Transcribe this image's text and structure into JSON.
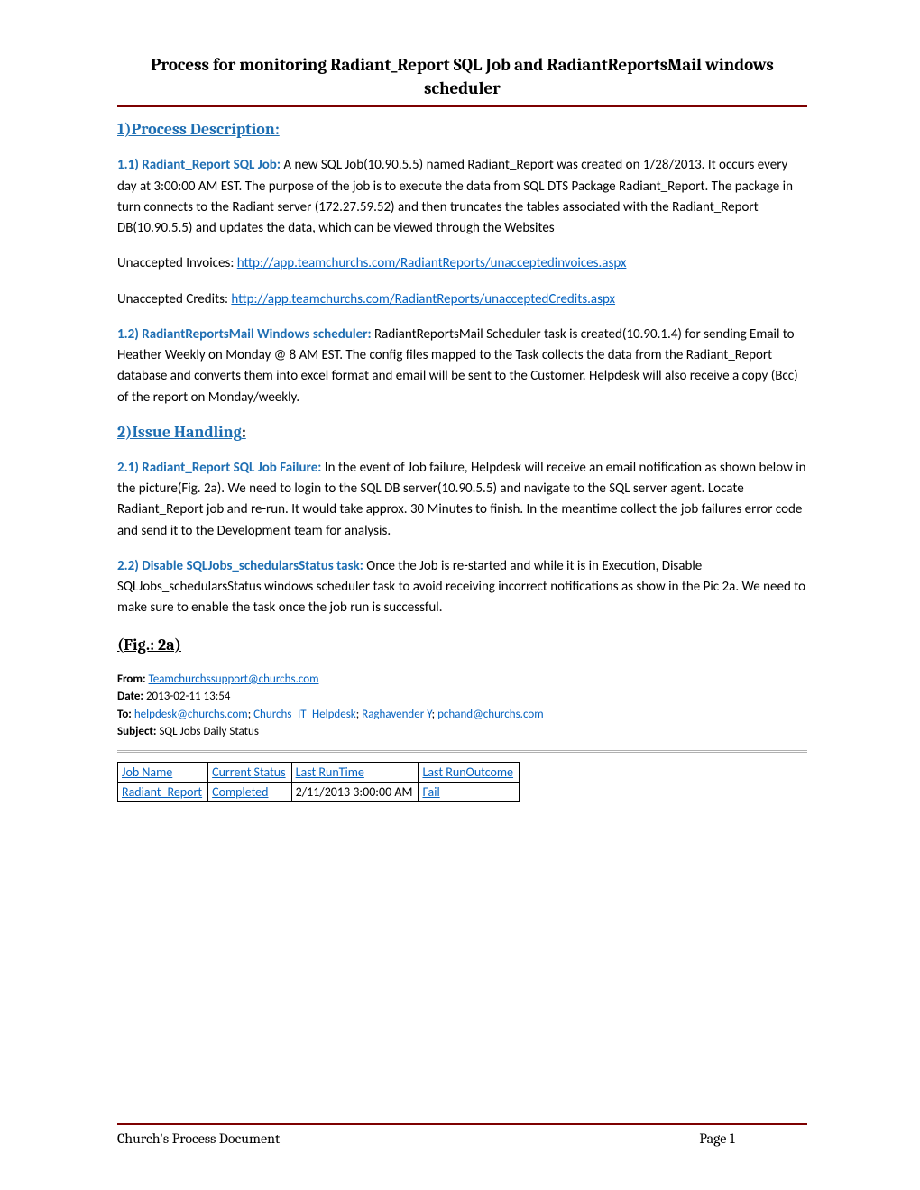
{
  "title": "Process for monitoring Radiant_Report SQL Job and RadiantReportsMail windows scheduler",
  "section1": {
    "heading": "1)Process Description:",
    "p11_lead": "1.1) Radiant_Report SQL Job",
    "p11_body": " A new SQL Job(10.90.5.5) named Radiant_Report was created on 1/28/2013. It occurs every day at 3:00:00 AM EST. The purpose of the job is to execute the data from SQL DTS Package Radiant_Report. The package in turn connects to the Radiant server (172.27.59.52) and then truncates the tables associated with the Radiant_Report DB(10.90.5.5) and updates the data, which can be viewed through the Websites",
    "unaccepted_invoices_label": "Unaccepted Invoices: ",
    "unaccepted_invoices_link": "http://app.teamchurchs.com/RadiantReports/unacceptedinvoices.aspx",
    "unaccepted_credits_label": "Unaccepted Credits:  ",
    "unaccepted_credits_link": "http://app.teamchurchs.com/RadiantReports/unacceptedCredits.aspx",
    "p12_lead": "1.2) RadiantReportsMail Windows scheduler:",
    "p12_body": " RadiantReportsMail Scheduler task is created(10.90.1.4) for sending Email to Heather Weekly on Monday @ 8 AM EST. The config files mapped to the Task collects the data from the Radiant_Report database and converts them into excel format and email will be sent to the Customer. Helpdesk will also receive a copy (Bcc) of the report on Monday/weekly."
  },
  "section2": {
    "heading": "2)Issue Handling",
    "colon": ":",
    "p21_lead": "2.1) Radiant_Report SQL Job Failure:",
    "p21_body": " In the event of Job failure, Helpdesk will receive an email notification as shown below in the picture(Fig. 2a). We need to login to the SQL DB server(10.90.5.5) and navigate to the SQL server agent. Locate Radiant_Report job and re-run. It would take approx. 30 Minutes to finish. In the meantime collect the job failures error code and send it to the Development team for analysis.",
    "p22_lead": "2.2) Disable SQLJobs_schedularsStatus task:",
    "p22_body": " Once the Job is re-started and while it is in Execution, Disable SQLJobs_schedularsStatus windows scheduler task to avoid receiving incorrect notifications as show in the Pic 2a. We need to make sure to enable the task once the job run is successful."
  },
  "fig": {
    "caption": "(Fig.: 2a)",
    "from_label": "From:",
    "from_value": "Teamchurchssupport@churchs.com",
    "date_label": "Date:",
    "date_value": "2013-02-11 13:54",
    "to_label": "To:",
    "to_values": [
      "helpdesk@churchs.com",
      "Churchs_IT_Helpdesk",
      "Raghavender Y",
      "pchand@churchs.com"
    ],
    "to_sep": "; ",
    "subject_label": "Subject:",
    "subject_value": "SQL Jobs Daily Status"
  },
  "table": {
    "headers": [
      "Job Name",
      "Current Status",
      "Last RunTime",
      "Last RunOutcome"
    ],
    "rows": [
      {
        "job": "Radiant_Report",
        "status": "Completed",
        "time": "2/11/2013 3:00:00 AM",
        "outcome": "Fail"
      }
    ]
  },
  "footer": {
    "left": "Church's Process Document",
    "center": "Page 1"
  }
}
